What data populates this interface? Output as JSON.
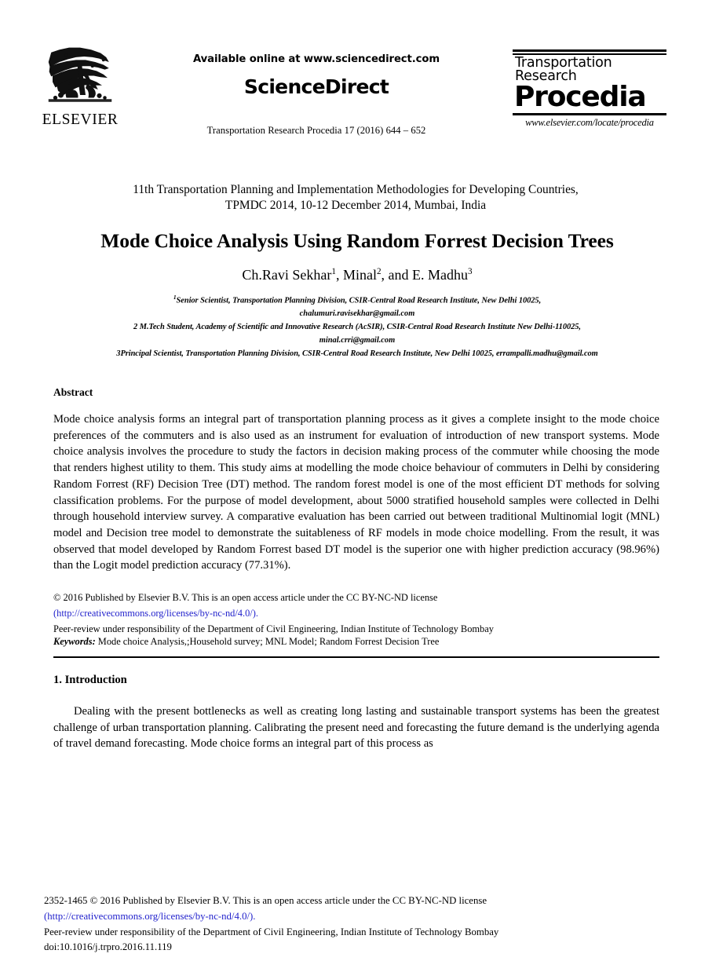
{
  "header": {
    "publisher_logo_label": "ELSEVIER",
    "publisher_logo_icon": "elsevier-tree-icon",
    "available_online": "Available online at www.sciencedirect.com",
    "sciencedirect_wordmark": "ScienceDirect",
    "journal_reference": "Transportation Research Procedia 17 (2016) 644 – 652",
    "journal_logo": {
      "line1": "Transportation",
      "line2": "Research",
      "line3": "Procedia",
      "url": "www.elsevier.com/locate/procedia"
    }
  },
  "conference": {
    "line1": "11th Transportation Planning and Implementation Methodologies for Developing Countries,",
    "line2": "TPMDC 2014, 10-12 December 2014, Mumbai, India"
  },
  "article": {
    "title": "Mode Choice Analysis Using Random Forrest Decision Trees",
    "authors_html": "Ch.Ravi Sekhar<sup>1</sup>, Minal<sup>2</sup>, and E. Madhu<sup>3</sup>",
    "affiliations": [
      {
        "marker": "1",
        "text": "Senior Scientist, Transportation Planning Division, CSIR-Central Road Research Institute, New Delhi 10025,",
        "email": "chalumuri.ravisekhar@gmail.com"
      },
      {
        "marker": "2",
        "text": "M.Tech Student, Academy of Scientific and Innovative Research (AcSIR), CSIR-Central Road Research Institute New Delhi-110025,",
        "email": "minal.crri@gmail.com"
      },
      {
        "marker": "3",
        "text": "Principal Scientist, Transportation Planning Division, CSIR-Central Road Research Institute, New Delhi 10025, errampalli.madhu@gmail.com",
        "email": ""
      }
    ]
  },
  "abstract": {
    "heading": "Abstract",
    "body": "Mode choice analysis forms an integral part of transportation planning process as it gives a complete insight to the mode choice preferences of the commuters and is also used as an instrument for evaluation of introduction of new transport systems. Mode choice analysis involves the procedure to study the factors in decision making process of the commuter while choosing the mode that renders highest utility to them. This study aims at modelling the mode choice behaviour of commuters in Delhi by considering Random Forrest (RF) Decision Tree (DT) method. The random forest model is one of the most efficient DT methods for solving classification problems. For the purpose of model development, about 5000 stratified household samples were collected in Delhi through household interview survey. A comparative evaluation has been carried out between traditional Multinomial logit (MNL) model and Decision tree model to demonstrate the suitableness of RF models in mode choice modelling. From the result, it was observed that model developed by Random Forrest based DT model is the superior one with higher prediction accuracy (98.96%) than the Logit model prediction accuracy (77.31%)."
  },
  "license": {
    "line1": "© 2016 Published by Elsevier B.V. This is an open access article under the CC BY-NC-ND license",
    "link": "(http://creativecommons.org/licenses/by-nc-nd/4.0/).",
    "line3": "Peer-review under responsibility of the Department of Civil Engineering, Indian Institute of Technology Bombay",
    "link_color": "#2222cc"
  },
  "keywords": {
    "label": "Keywords:",
    "value": " Mode choice Analysis,;Household survey; MNL Model; Random Forrest Decision Tree"
  },
  "introduction": {
    "heading": "1. Introduction",
    "body": "Dealing with the present bottlenecks as well as creating long lasting and sustainable transport systems has been the greatest challenge of urban transportation planning. Calibrating the present need and forecasting the future demand is the underlying agenda of travel demand forecasting. Mode choice forms an integral part of this process as"
  },
  "footer": {
    "line1": "2352-1465 © 2016 Published by Elsevier B.V. This is an open access article under the CC BY-NC-ND license",
    "link": "(http://creativecommons.org/licenses/by-nc-nd/4.0/).",
    "line3": "Peer-review under responsibility of the Department of Civil Engineering, Indian Institute of Technology Bombay",
    "doi": "doi:10.1016/j.trpro.2016.11.119"
  }
}
